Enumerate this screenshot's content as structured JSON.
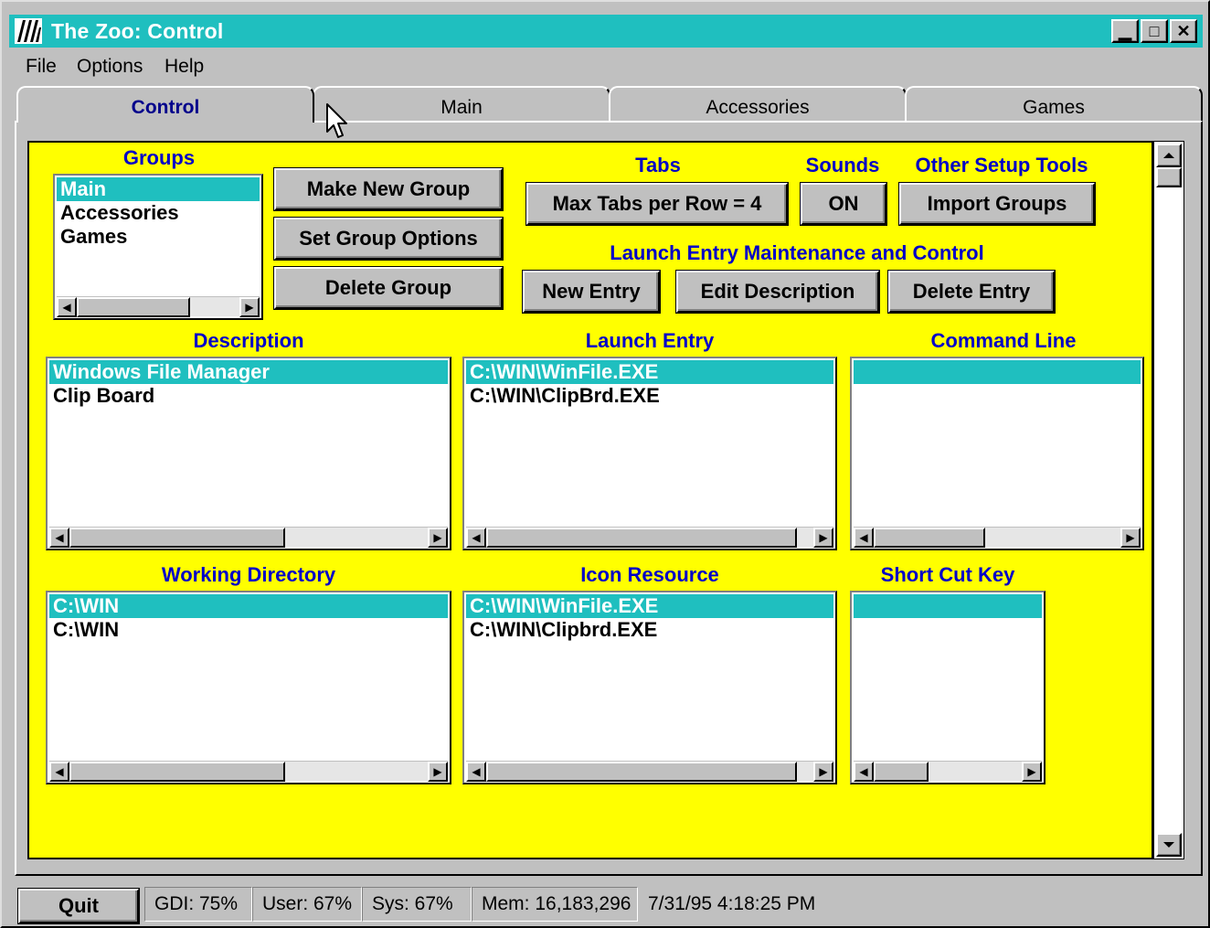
{
  "window": {
    "title": "The Zoo: Control"
  },
  "menu": [
    "File",
    "Options",
    "Help"
  ],
  "tabs": [
    "Control",
    "Main",
    "Accessories",
    "Games"
  ],
  "groups": {
    "label": "Groups",
    "items": [
      "Main",
      "Accessories",
      "Games"
    ],
    "selected": 0
  },
  "group_buttons": {
    "make_new": "Make New Group",
    "set_options": "Set Group Options",
    "delete": "Delete Group"
  },
  "tabs_section": {
    "label": "Tabs",
    "button": "Max Tabs per Row = 4"
  },
  "sounds_section": {
    "label": "Sounds",
    "button": "ON"
  },
  "setup_section": {
    "label": "Other Setup Tools",
    "button": "Import Groups"
  },
  "launch_section": {
    "label": "Launch Entry Maintenance and Control",
    "new_entry": "New Entry",
    "edit_description": "Edit Description",
    "delete_entry": "Delete Entry"
  },
  "lists": {
    "description": {
      "label": "Description",
      "items": [
        "Windows File Manager",
        "Clip Board"
      ]
    },
    "launch_entry": {
      "label": "Launch Entry",
      "items": [
        "C:\\WIN\\WinFile.EXE",
        "C:\\WIN\\ClipBrd.EXE"
      ]
    },
    "command_line": {
      "label": "Command Line",
      "items": [
        ""
      ]
    },
    "working_directory": {
      "label": "Working Directory",
      "items": [
        "C:\\WIN",
        "C:\\WIN"
      ]
    },
    "icon_resource": {
      "label": "Icon Resource",
      "items": [
        "C:\\WIN\\WinFile.EXE",
        "C:\\WIN\\Clipbrd.EXE"
      ]
    },
    "short_cut_key": {
      "label": "Short Cut Key",
      "items": [
        ""
      ]
    }
  },
  "status": {
    "quit": "Quit",
    "gdi": "GDI: 75%",
    "user": "User: 67%",
    "sys": "Sys: 67%",
    "mem": "Mem: 16,183,296",
    "datetime": "7/31/95 4:18:25 PM"
  },
  "colors": {
    "titlebar": "#1fbfbf",
    "panel": "#ffff00",
    "label": "#0000c8",
    "selection": "#1fbfbf"
  }
}
